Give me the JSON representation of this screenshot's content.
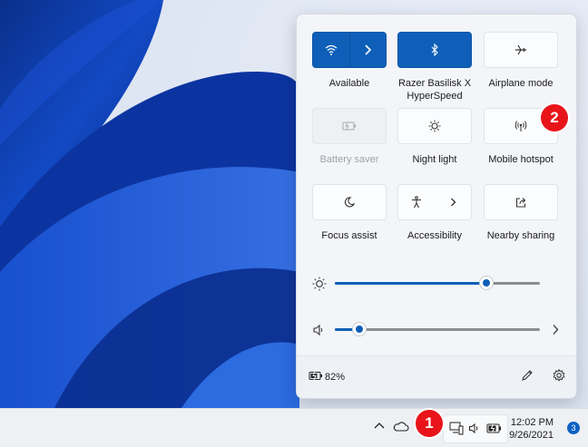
{
  "quick_settings": {
    "tiles": [
      {
        "id": "wifi",
        "label": "Available",
        "state": "on",
        "icon": "wifi-icon",
        "has_arrow": true
      },
      {
        "id": "bluetooth",
        "label": "Razer Basilisk X HyperSpeed",
        "state": "on",
        "icon": "bluetooth-icon"
      },
      {
        "id": "airplane",
        "label": "Airplane mode",
        "state": "off",
        "icon": "airplane-icon"
      },
      {
        "id": "battery-saver",
        "label": "Battery saver",
        "state": "disabled",
        "icon": "battery-saver-icon"
      },
      {
        "id": "night-light",
        "label": "Night light",
        "state": "off",
        "icon": "night-light-icon"
      },
      {
        "id": "mobile-hotspot",
        "label": "Mobile hotspot",
        "state": "off",
        "icon": "mobile-hotspot-icon"
      },
      {
        "id": "focus-assist",
        "label": "Focus assist",
        "state": "off",
        "icon": "moon-icon"
      },
      {
        "id": "accessibility",
        "label": "Accessibility",
        "state": "off",
        "icon": "accessibility-icon",
        "has_arrow": true
      },
      {
        "id": "nearby-sharing",
        "label": "Nearby sharing",
        "state": "off",
        "icon": "share-icon"
      }
    ],
    "brightness": {
      "icon": "brightness-icon",
      "level": 0.74
    },
    "volume": {
      "icon": "speaker-icon",
      "level": 0.12
    },
    "battery": {
      "icon": "battery-charging-icon",
      "percent": "82%"
    },
    "accent_color": "#0f5fb8"
  },
  "callouts": {
    "one": "1",
    "two": "2",
    "color": "#e8141a"
  },
  "taskbar": {
    "time": "12:02 PM",
    "date": "9/26/2021",
    "notification_count": "3",
    "tray_icons": [
      "chevron-up-icon",
      "onedrive-icon",
      "network-icon",
      "volume-icon",
      "battery-icon"
    ]
  }
}
